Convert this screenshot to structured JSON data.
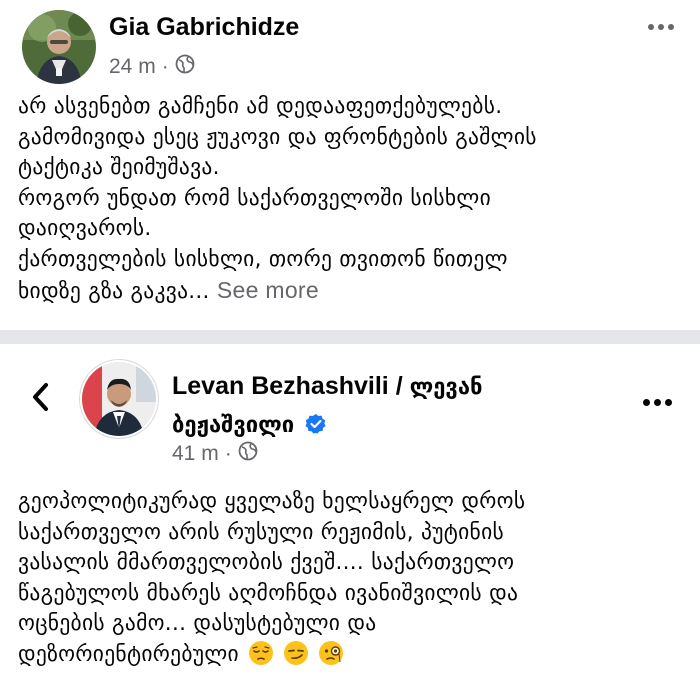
{
  "post1": {
    "author": "Gia Gabrichidze",
    "time": "24 m",
    "separator": "·",
    "privacy_icon": "globe-icon",
    "lines": [
      "არ ასვენებთ გამჩენი ამ დედააფეთქებულებს.",
      "გამომივიდა ესეც ჟუკოვი და ფრონტების გაშლის",
      "ტაქტიკა შეიმუშავა.",
      "როგორ უნდათ რომ საქართველოში სისხლი",
      "დაიღვაროს.",
      "ქართველების სისხლი, თორე თვითონ წითელ"
    ],
    "last_line": "ხიდზე გზა გაკვა...",
    "see_more": "See more"
  },
  "post2": {
    "author_latin": "Levan Bezhashvili / ",
    "author_geo_1": "ლევან",
    "author_geo_2": "ბეჟაშვილი",
    "time": "41 m",
    "separator": "·",
    "privacy_icon": "globe-icon",
    "lines": [
      "გეოპოლიტიკურად ყველაზე ხელსაყრელ დროს",
      "საქართველო არის რუსული რეჟიმის, პუტინის",
      "ვასალის მმართველობის ქვეშ.... საქართველო",
      "წაგებულოს მხარეს აღმოჩნდა ივანიშვილის და",
      "ოცნების გამო... დასუსტებული და"
    ],
    "last_line": "დეზორიენტირებული",
    "emojis": [
      "pensive-face",
      "smirking-face",
      "face-with-monocle"
    ]
  },
  "colors": {
    "text": "#050505",
    "secondary": "#65676b",
    "separator_band": "#e4e6ea",
    "verified_blue": "#1877f2"
  }
}
